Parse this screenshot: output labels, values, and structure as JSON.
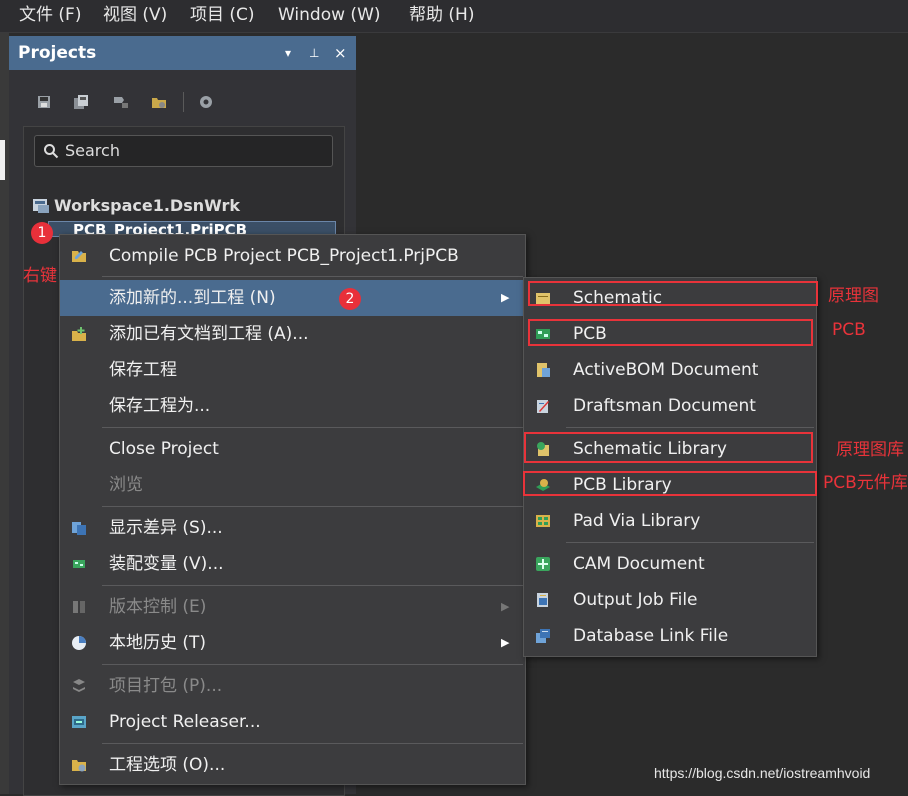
{
  "menubar": {
    "items": [
      "文件 (F)",
      "视图 (V)",
      "项目 (C)",
      "Window (W)",
      "帮助 (H)"
    ]
  },
  "panel": {
    "title": "Projects",
    "buttons": [
      "▾",
      "⊥",
      "×"
    ],
    "search_placeholder": "Search",
    "workspace": "Workspace1.DsnWrk",
    "project": "PCB_Project1.PrjPCB"
  },
  "annotations": {
    "badge1": "1",
    "badge2": "2",
    "right_click": "右键",
    "schematic": "原理图",
    "pcb": "PCB",
    "schematic_library": "原理图库",
    "pcb_library": "PCB元件库"
  },
  "context_menu": {
    "items": [
      {
        "label": "Compile PCB Project PCB_Project1.PrjPCB",
        "icon": "compile-icon"
      },
      {
        "label": "添加新的...到工程 (N)",
        "icon": "",
        "submenu": true,
        "highlighted": true
      },
      {
        "label": "添加已有文档到工程 (A)...",
        "icon": "add-existing-icon"
      },
      {
        "label": "保存工程",
        "icon": ""
      },
      {
        "label": "保存工程为...",
        "icon": ""
      },
      {
        "label": "Close Project",
        "icon": ""
      },
      {
        "label": "浏览",
        "icon": "",
        "disabled": true
      },
      {
        "label": "显示差异 (S)...",
        "icon": "diff-icon"
      },
      {
        "label": "装配变量 (V)...",
        "icon": "variants-icon"
      },
      {
        "label": "版本控制 (E)",
        "icon": "version-control-icon",
        "disabled": true,
        "submenu": true
      },
      {
        "label": "本地历史 (T)",
        "icon": "history-icon",
        "submenu": true
      },
      {
        "label": "项目打包 (P)...",
        "icon": "package-icon",
        "disabled": true
      },
      {
        "label": "Project Releaser...",
        "icon": "releaser-icon"
      },
      {
        "label": "工程选项 (O)...",
        "icon": "options-icon"
      }
    ],
    "submenu_arrow": "▶"
  },
  "submenu": {
    "items": [
      {
        "label": "Schematic",
        "icon": "schematic-icon"
      },
      {
        "label": "PCB",
        "icon": "pcb-icon"
      },
      {
        "label": "ActiveBOM Document",
        "icon": "bom-icon"
      },
      {
        "label": "Draftsman Document",
        "icon": "draftsman-icon"
      },
      {
        "label": "Schematic Library",
        "icon": "schlib-icon"
      },
      {
        "label": "PCB Library",
        "icon": "pcblib-icon"
      },
      {
        "label": "Pad Via Library",
        "icon": "padvia-icon"
      },
      {
        "label": "CAM Document",
        "icon": "cam-icon"
      },
      {
        "label": "Output Job File",
        "icon": "outjob-icon"
      },
      {
        "label": "Database Link File",
        "icon": "dblink-icon"
      }
    ]
  },
  "watermark": "https://blog.csdn.net/iostreamhvoid",
  "colors": {
    "accent": "#4a6b8f",
    "annotation_red": "#e8333a"
  }
}
